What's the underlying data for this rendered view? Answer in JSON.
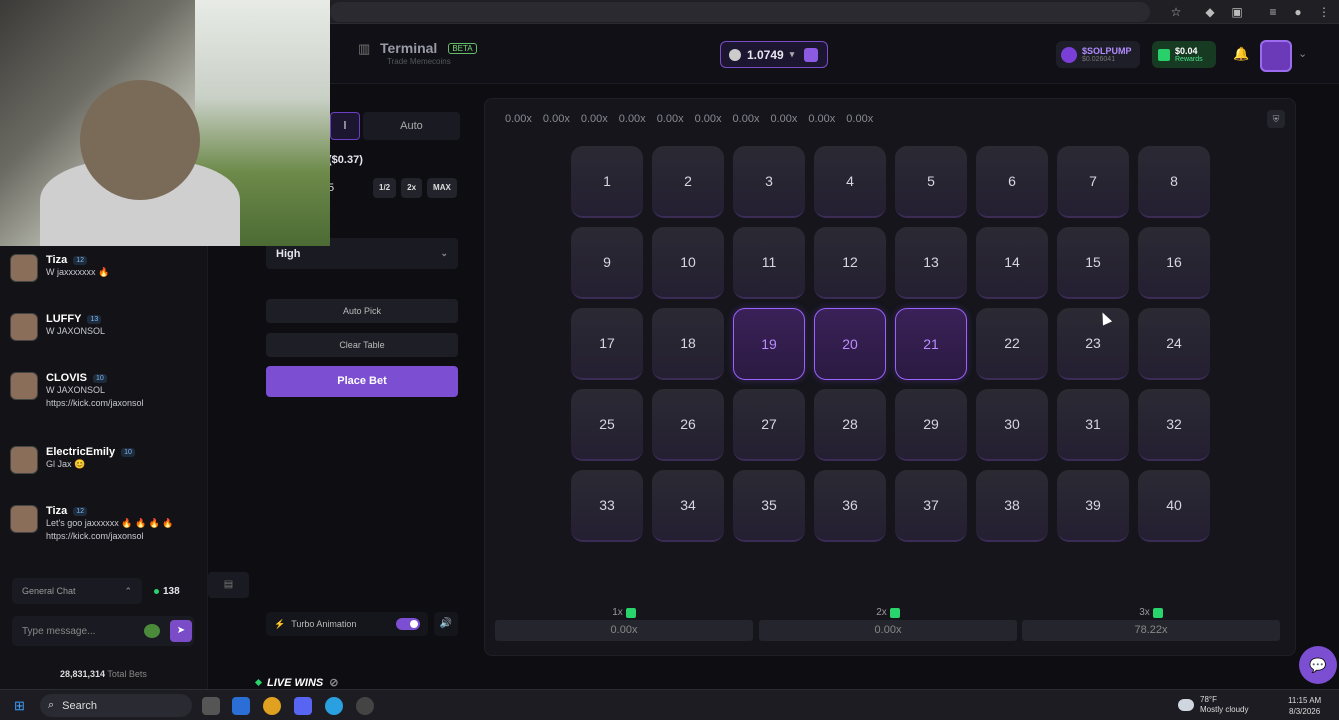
{
  "header": {
    "title": "Terminal",
    "beta": "BETA",
    "subtitle": "Trade Memecoins",
    "balance": "1.0749",
    "token_name": "$SOLPUMP",
    "token_price": "$0.026041",
    "rewards_amount": "$0.04",
    "rewards_label": "Rewards"
  },
  "panel": {
    "tab_manual_partial": "l",
    "tab_auto": "Auto",
    "amount_usd": "($0.37)",
    "amount_partial": "5",
    "half": "1/2",
    "double": "2x",
    "max": "MAX",
    "risk": "High",
    "auto_pick": "Auto Pick",
    "clear_table": "Clear Table",
    "place_bet": "Place Bet",
    "turbo": "Turbo Animation"
  },
  "board": {
    "multipliers": [
      "0.00x",
      "0.00x",
      "0.00x",
      "0.00x",
      "0.00x",
      "0.00x",
      "0.00x",
      "0.00x",
      "0.00x",
      "0.00x"
    ],
    "tiles": [
      "1",
      "2",
      "3",
      "4",
      "5",
      "6",
      "7",
      "8",
      "9",
      "10",
      "11",
      "12",
      "13",
      "14",
      "15",
      "16",
      "17",
      "18",
      "19",
      "20",
      "21",
      "22",
      "23",
      "24",
      "25",
      "26",
      "27",
      "28",
      "29",
      "30",
      "31",
      "32",
      "33",
      "34",
      "35",
      "36",
      "37",
      "38",
      "39",
      "40"
    ],
    "selected": [
      19,
      20,
      21
    ],
    "payouts": [
      {
        "label": "1x",
        "value": "0.00x"
      },
      {
        "label": "2x",
        "value": "0.00x"
      },
      {
        "label": "3x",
        "value": "78.22x"
      }
    ]
  },
  "chat": {
    "messages": [
      {
        "user": "Tiza",
        "level": "12",
        "text": "W jaxxxxxxx 🔥"
      },
      {
        "user": "LUFFY",
        "level": "13",
        "text": "W JAXONSOL"
      },
      {
        "user": "CLOVIS",
        "level": "10",
        "text": "W JAXONSOL\nhttps://kick.com/jaxonsol"
      },
      {
        "user": "ElectricEmily",
        "level": "10",
        "text": "Gl Jax 😊"
      },
      {
        "user": "Tiza",
        "level": "12",
        "text": "Let's goo jaxxxxxx 🔥 🔥 🔥 🔥\nhttps://kick.com/jaxonsol"
      }
    ],
    "channel": "General Chat",
    "online": "138",
    "placeholder": "Type message...",
    "total_bets_value": "28,831,314",
    "total_bets_label": "Total Bets"
  },
  "live_wins": "LIVE WINS",
  "taskbar": {
    "search": "Search",
    "temp": "78°F",
    "weather": "Mostly cloudy",
    "time": "11:15 AM",
    "date": "8/3/2026"
  }
}
